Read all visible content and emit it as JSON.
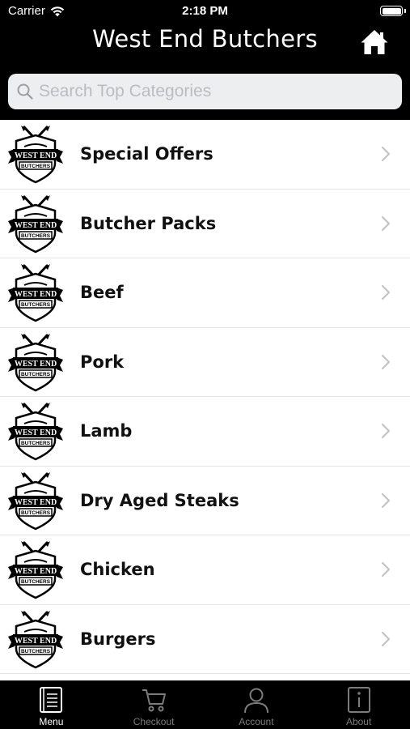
{
  "status_bar": {
    "carrier": "Carrier",
    "time": "2:18 PM",
    "wifi_icon": "wifi-icon",
    "battery_icon": "battery-icon"
  },
  "nav": {
    "title": "West End Butchers",
    "home_icon": "home-icon"
  },
  "search": {
    "placeholder": "Search Top Categories",
    "value": "",
    "icon": "search-icon"
  },
  "brand": {
    "logo_line1": "WEST END",
    "logo_line2": "BUTCHERS"
  },
  "categories": [
    {
      "label": "Special Offers"
    },
    {
      "label": "Butcher Packs"
    },
    {
      "label": "Beef"
    },
    {
      "label": "Pork"
    },
    {
      "label": "Lamb"
    },
    {
      "label": "Dry Aged Steaks"
    },
    {
      "label": "Chicken"
    },
    {
      "label": "Burgers"
    }
  ],
  "tabs": [
    {
      "label": "Menu",
      "icon": "menu-book-icon",
      "active": true
    },
    {
      "label": "Checkout",
      "icon": "cart-icon",
      "active": false
    },
    {
      "label": "Account",
      "icon": "person-icon",
      "active": false
    },
    {
      "label": "About",
      "icon": "info-icon",
      "active": false
    }
  ],
  "colors": {
    "header_bg": "#000000",
    "search_bg": "#eceef0",
    "list_bg": "#ffffff",
    "tab_active": "#ffffff",
    "tab_inactive": "#7b7b7b"
  }
}
